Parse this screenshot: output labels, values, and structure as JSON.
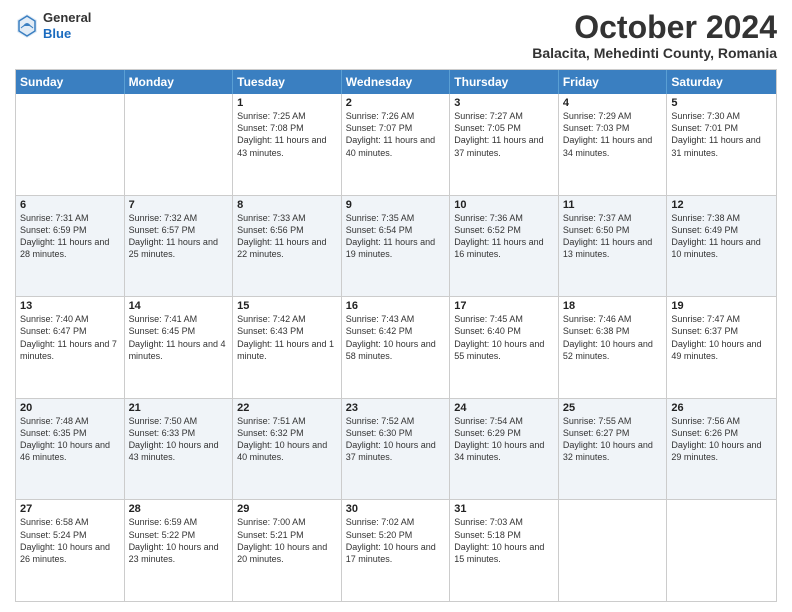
{
  "logo": {
    "general": "General",
    "blue": "Blue"
  },
  "header": {
    "month": "October 2024",
    "location": "Balacita, Mehedinti County, Romania"
  },
  "weekdays": [
    "Sunday",
    "Monday",
    "Tuesday",
    "Wednesday",
    "Thursday",
    "Friday",
    "Saturday"
  ],
  "rows": [
    [
      {
        "day": "",
        "sunrise": "",
        "sunset": "",
        "daylight": ""
      },
      {
        "day": "",
        "sunrise": "",
        "sunset": "",
        "daylight": ""
      },
      {
        "day": "1",
        "sunrise": "Sunrise: 7:25 AM",
        "sunset": "Sunset: 7:08 PM",
        "daylight": "Daylight: 11 hours and 43 minutes."
      },
      {
        "day": "2",
        "sunrise": "Sunrise: 7:26 AM",
        "sunset": "Sunset: 7:07 PM",
        "daylight": "Daylight: 11 hours and 40 minutes."
      },
      {
        "day": "3",
        "sunrise": "Sunrise: 7:27 AM",
        "sunset": "Sunset: 7:05 PM",
        "daylight": "Daylight: 11 hours and 37 minutes."
      },
      {
        "day": "4",
        "sunrise": "Sunrise: 7:29 AM",
        "sunset": "Sunset: 7:03 PM",
        "daylight": "Daylight: 11 hours and 34 minutes."
      },
      {
        "day": "5",
        "sunrise": "Sunrise: 7:30 AM",
        "sunset": "Sunset: 7:01 PM",
        "daylight": "Daylight: 11 hours and 31 minutes."
      }
    ],
    [
      {
        "day": "6",
        "sunrise": "Sunrise: 7:31 AM",
        "sunset": "Sunset: 6:59 PM",
        "daylight": "Daylight: 11 hours and 28 minutes."
      },
      {
        "day": "7",
        "sunrise": "Sunrise: 7:32 AM",
        "sunset": "Sunset: 6:57 PM",
        "daylight": "Daylight: 11 hours and 25 minutes."
      },
      {
        "day": "8",
        "sunrise": "Sunrise: 7:33 AM",
        "sunset": "Sunset: 6:56 PM",
        "daylight": "Daylight: 11 hours and 22 minutes."
      },
      {
        "day": "9",
        "sunrise": "Sunrise: 7:35 AM",
        "sunset": "Sunset: 6:54 PM",
        "daylight": "Daylight: 11 hours and 19 minutes."
      },
      {
        "day": "10",
        "sunrise": "Sunrise: 7:36 AM",
        "sunset": "Sunset: 6:52 PM",
        "daylight": "Daylight: 11 hours and 16 minutes."
      },
      {
        "day": "11",
        "sunrise": "Sunrise: 7:37 AM",
        "sunset": "Sunset: 6:50 PM",
        "daylight": "Daylight: 11 hours and 13 minutes."
      },
      {
        "day": "12",
        "sunrise": "Sunrise: 7:38 AM",
        "sunset": "Sunset: 6:49 PM",
        "daylight": "Daylight: 11 hours and 10 minutes."
      }
    ],
    [
      {
        "day": "13",
        "sunrise": "Sunrise: 7:40 AM",
        "sunset": "Sunset: 6:47 PM",
        "daylight": "Daylight: 11 hours and 7 minutes."
      },
      {
        "day": "14",
        "sunrise": "Sunrise: 7:41 AM",
        "sunset": "Sunset: 6:45 PM",
        "daylight": "Daylight: 11 hours and 4 minutes."
      },
      {
        "day": "15",
        "sunrise": "Sunrise: 7:42 AM",
        "sunset": "Sunset: 6:43 PM",
        "daylight": "Daylight: 11 hours and 1 minute."
      },
      {
        "day": "16",
        "sunrise": "Sunrise: 7:43 AM",
        "sunset": "Sunset: 6:42 PM",
        "daylight": "Daylight: 10 hours and 58 minutes."
      },
      {
        "day": "17",
        "sunrise": "Sunrise: 7:45 AM",
        "sunset": "Sunset: 6:40 PM",
        "daylight": "Daylight: 10 hours and 55 minutes."
      },
      {
        "day": "18",
        "sunrise": "Sunrise: 7:46 AM",
        "sunset": "Sunset: 6:38 PM",
        "daylight": "Daylight: 10 hours and 52 minutes."
      },
      {
        "day": "19",
        "sunrise": "Sunrise: 7:47 AM",
        "sunset": "Sunset: 6:37 PM",
        "daylight": "Daylight: 10 hours and 49 minutes."
      }
    ],
    [
      {
        "day": "20",
        "sunrise": "Sunrise: 7:48 AM",
        "sunset": "Sunset: 6:35 PM",
        "daylight": "Daylight: 10 hours and 46 minutes."
      },
      {
        "day": "21",
        "sunrise": "Sunrise: 7:50 AM",
        "sunset": "Sunset: 6:33 PM",
        "daylight": "Daylight: 10 hours and 43 minutes."
      },
      {
        "day": "22",
        "sunrise": "Sunrise: 7:51 AM",
        "sunset": "Sunset: 6:32 PM",
        "daylight": "Daylight: 10 hours and 40 minutes."
      },
      {
        "day": "23",
        "sunrise": "Sunrise: 7:52 AM",
        "sunset": "Sunset: 6:30 PM",
        "daylight": "Daylight: 10 hours and 37 minutes."
      },
      {
        "day": "24",
        "sunrise": "Sunrise: 7:54 AM",
        "sunset": "Sunset: 6:29 PM",
        "daylight": "Daylight: 10 hours and 34 minutes."
      },
      {
        "day": "25",
        "sunrise": "Sunrise: 7:55 AM",
        "sunset": "Sunset: 6:27 PM",
        "daylight": "Daylight: 10 hours and 32 minutes."
      },
      {
        "day": "26",
        "sunrise": "Sunrise: 7:56 AM",
        "sunset": "Sunset: 6:26 PM",
        "daylight": "Daylight: 10 hours and 29 minutes."
      }
    ],
    [
      {
        "day": "27",
        "sunrise": "Sunrise: 6:58 AM",
        "sunset": "Sunset: 5:24 PM",
        "daylight": "Daylight: 10 hours and 26 minutes."
      },
      {
        "day": "28",
        "sunrise": "Sunrise: 6:59 AM",
        "sunset": "Sunset: 5:22 PM",
        "daylight": "Daylight: 10 hours and 23 minutes."
      },
      {
        "day": "29",
        "sunrise": "Sunrise: 7:00 AM",
        "sunset": "Sunset: 5:21 PM",
        "daylight": "Daylight: 10 hours and 20 minutes."
      },
      {
        "day": "30",
        "sunrise": "Sunrise: 7:02 AM",
        "sunset": "Sunset: 5:20 PM",
        "daylight": "Daylight: 10 hours and 17 minutes."
      },
      {
        "day": "31",
        "sunrise": "Sunrise: 7:03 AM",
        "sunset": "Sunset: 5:18 PM",
        "daylight": "Daylight: 10 hours and 15 minutes."
      },
      {
        "day": "",
        "sunrise": "",
        "sunset": "",
        "daylight": ""
      },
      {
        "day": "",
        "sunrise": "",
        "sunset": "",
        "daylight": ""
      }
    ]
  ]
}
